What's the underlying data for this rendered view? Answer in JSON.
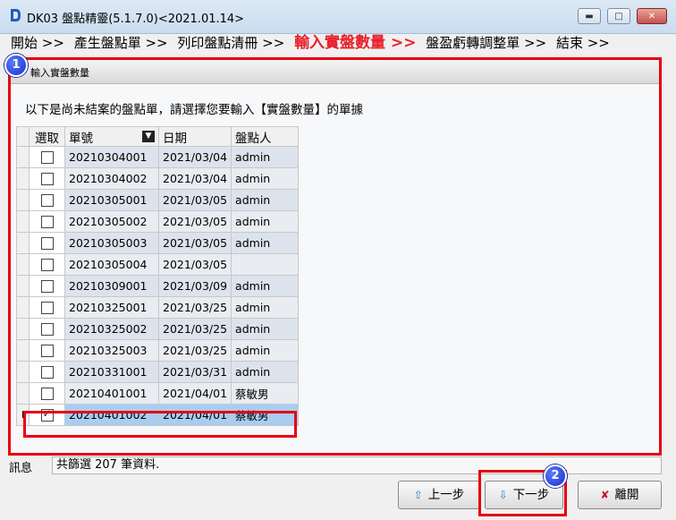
{
  "window": {
    "title": "DK03 盤點精靈(5.1.7.0)<2021.01.14>",
    "minimize_glyph": "▬",
    "maximize_glyph": "□",
    "close_glyph": "✕"
  },
  "steps": [
    {
      "label": "開始 >>"
    },
    {
      "label": "產生盤點單 >>"
    },
    {
      "label": "列印盤點清冊 >>"
    },
    {
      "label": "輸入實盤數量 >>",
      "active": true
    },
    {
      "label": "盤盈虧轉調整單 >>"
    },
    {
      "label": "結束 >>"
    }
  ],
  "panel": {
    "title": "輸入實盤數量",
    "badge": "1",
    "instruction": "以下是尚未結案的盤點單，請選擇您要輸入【實盤數量】的單據"
  },
  "grid": {
    "headers": {
      "select": "選取",
      "no": "單號",
      "date": "日期",
      "person": "盤點人"
    },
    "rows": [
      {
        "checked": false,
        "no": "20210304001",
        "date": "2021/03/04",
        "person": "admin"
      },
      {
        "checked": false,
        "no": "20210304002",
        "date": "2021/03/04",
        "person": "admin"
      },
      {
        "checked": false,
        "no": "20210305001",
        "date": "2021/03/05",
        "person": "admin"
      },
      {
        "checked": false,
        "no": "20210305002",
        "date": "2021/03/05",
        "person": "admin"
      },
      {
        "checked": false,
        "no": "20210305003",
        "date": "2021/03/05",
        "person": "admin"
      },
      {
        "checked": false,
        "no": "20210305004",
        "date": "2021/03/05",
        "person": ""
      },
      {
        "checked": false,
        "no": "20210309001",
        "date": "2021/03/09",
        "person": "admin"
      },
      {
        "checked": false,
        "no": "20210325001",
        "date": "2021/03/25",
        "person": "admin"
      },
      {
        "checked": false,
        "no": "20210325002",
        "date": "2021/03/25",
        "person": "admin"
      },
      {
        "checked": false,
        "no": "20210325003",
        "date": "2021/03/25",
        "person": "admin"
      },
      {
        "checked": false,
        "no": "20210331001",
        "date": "2021/03/31",
        "person": "admin"
      },
      {
        "checked": false,
        "no": "20210401001",
        "date": "2021/04/01",
        "person": "蔡敏男"
      },
      {
        "checked": true,
        "no": "20210401002",
        "date": "2021/04/01",
        "person": "蔡敏男",
        "current": true
      }
    ],
    "current_row_indicator": "I"
  },
  "message": {
    "label": "訊息",
    "text": "共篩選 207 筆資料."
  },
  "buttons": {
    "prev": {
      "label": "上一步",
      "icon": "⇧"
    },
    "next": {
      "label": "下一步",
      "icon": "⇩",
      "badge": "2"
    },
    "exit": {
      "label": "離開",
      "icon": "✘"
    }
  },
  "colors": {
    "highlight": "#e60012",
    "active_step": "#e8202a",
    "badge": "#1530c8"
  }
}
